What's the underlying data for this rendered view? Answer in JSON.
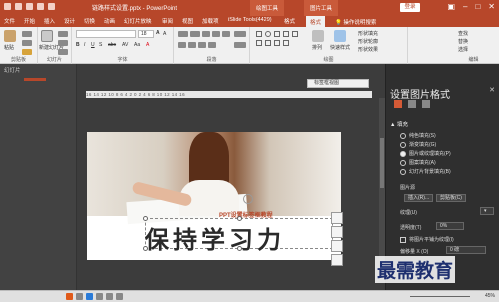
{
  "window": {
    "doc_title": "链路样式设置.pptx  -  PowerPoint",
    "context_tab_1": "绘图工具",
    "context_tab_2": "图片工具",
    "login": "登录"
  },
  "tabs": [
    "文件",
    "开始",
    "插入",
    "设计",
    "切换",
    "动画",
    "幻灯片放映",
    "审阅",
    "视图",
    "加载项",
    "iSlide Tools(4429)",
    "格式",
    "格式"
  ],
  "search_label": "操作说明搜索",
  "ribbon": {
    "groups": [
      "剪贴板",
      "幻灯片",
      "字体",
      "段落",
      "绘图",
      "编辑"
    ],
    "font_size": "18",
    "paste": "粘贴",
    "new_slide": "新建幻灯片",
    "arrange": "排列",
    "quick_styles": "快速样式",
    "shape_fill": "形状填充",
    "shape_outline": "形状轮廓",
    "shape_effects": "形状效果",
    "find": "查找",
    "replace": "替换",
    "select": "选择"
  },
  "left_pane": {
    "label": "幻灯片"
  },
  "ruler_text": "16  14  12  10  8  6  4  2  0  2  4  6  8  10  12  14  16",
  "float_toolbar": "标签框视图",
  "slide": {
    "subtitle": "PPT设置标签框教程",
    "title": "保持学习力"
  },
  "panel": {
    "title": "设置图片格式",
    "section": "填充",
    "radios": [
      "纯色填充(S)",
      "渐变填充(G)",
      "图片或纹理填充(P)",
      "图案填充(A)",
      "幻灯片背景填充(B)"
    ],
    "selected_radio": 2,
    "image_source": "图片源",
    "insert_btn": "插入(R)...",
    "clipboard_btn": "剪贴板(C)",
    "texture_label": "纹理(U)",
    "transparency_label": "透明度(T)",
    "transparency_value": "0%",
    "tile_check": "将图片平铺为纹理(I)",
    "offset_x_label": "偏移量 X (O)",
    "offset_x_value": "0 磅"
  },
  "watermark": "最需教育",
  "status": {
    "zoom": "45%"
  }
}
